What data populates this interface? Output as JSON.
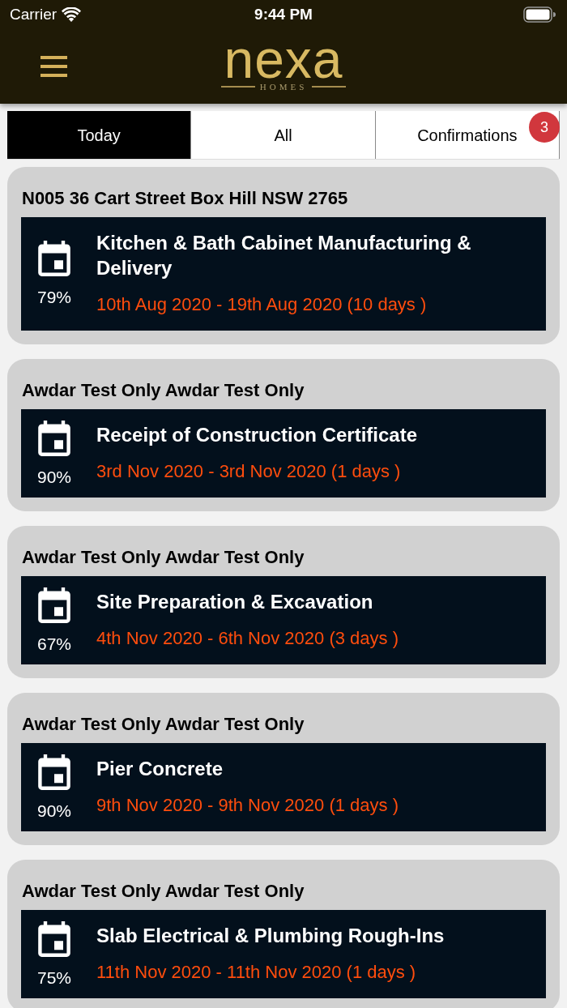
{
  "status_bar": {
    "carrier": "Carrier",
    "time": "9:44 PM"
  },
  "header": {
    "logo": {
      "wordmark": "nexa",
      "tagline": "HOMES"
    }
  },
  "tabs": [
    {
      "label": "Today",
      "selected": true
    },
    {
      "label": "All",
      "selected": false
    },
    {
      "label": "Confirmations",
      "selected": false,
      "badge": "3"
    }
  ],
  "tasks": [
    {
      "address": "N005 36 Cart Street Box Hill NSW 2765",
      "progress": "79%",
      "title": "Kitchen & Bath Cabinet Manufacturing & Delivery",
      "dates": "10th Aug 2020 - 19th Aug 2020 (10 days )"
    },
    {
      "address": "Awdar Test Only Awdar Test Only",
      "progress": "90%",
      "title": "Receipt of Construction Certificate",
      "dates": "3rd Nov 2020 - 3rd Nov 2020 (1 days )"
    },
    {
      "address": "Awdar Test Only Awdar Test Only",
      "progress": "67%",
      "title": "Site Preparation & Excavation",
      "dates": "4th Nov 2020 - 6th Nov 2020 (3 days )"
    },
    {
      "address": "Awdar Test Only Awdar Test Only",
      "progress": "90%",
      "title": "Pier Concrete",
      "dates": "9th Nov 2020 - 9th Nov 2020 (1 days )"
    },
    {
      "address": "Awdar Test Only Awdar Test Only",
      "progress": "75%",
      "title": "Slab Electrical & Plumbing Rough-Ins",
      "dates": "11th Nov 2020 - 11th Nov 2020 (1 days )"
    }
  ]
}
